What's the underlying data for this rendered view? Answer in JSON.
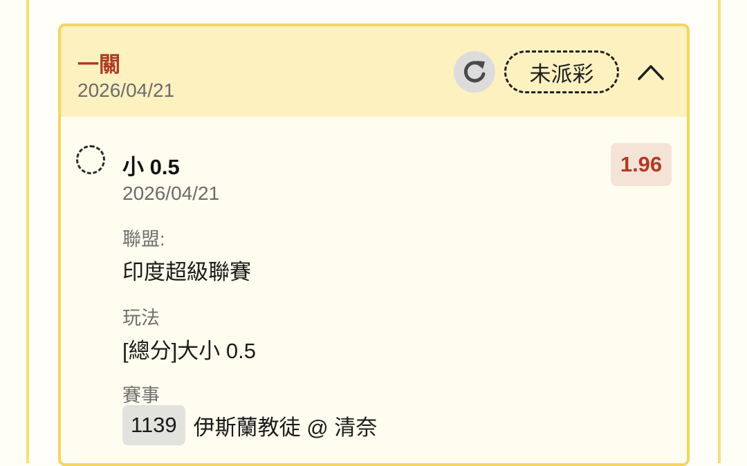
{
  "header": {
    "title": "一關",
    "date": "2026/04/21",
    "status": "未派彩",
    "refresh_icon": "refresh-icon",
    "collapse_icon": "chevron-up-icon"
  },
  "bet": {
    "selection": "小 0.5",
    "odds": "1.96",
    "date": "2026/04/21",
    "league_label": "聯盟:",
    "league": "印度超級聯賽",
    "market_label": "玩法",
    "market": "[總分]大小 0.5",
    "event_label": "賽事",
    "event_id": "1139",
    "event_name": "伊斯蘭教徒 @ 清奈"
  },
  "colors": {
    "accent_red": "#b23a24",
    "header_bg": "#fdf1c0",
    "border_yellow": "#f4d55f"
  }
}
